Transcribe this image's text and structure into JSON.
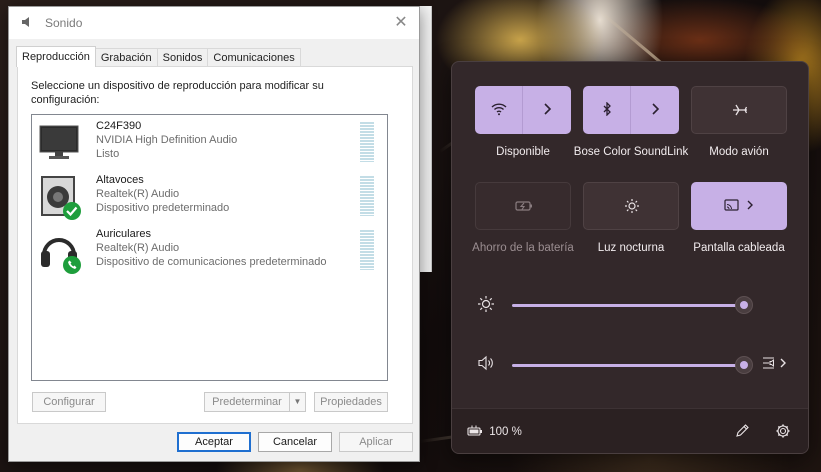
{
  "dialog": {
    "title": "Sonido",
    "close_glyph": "✕",
    "tabs": [
      "Reproducción",
      "Grabación",
      "Sonidos",
      "Comunicaciones"
    ],
    "instruction": "Seleccione un dispositivo de reproducción para modificar su configuración:",
    "devices": [
      {
        "name": "C24F390",
        "line1": "NVIDIA High Definition Audio",
        "line2": "Listo",
        "icon": "monitor-icon"
      },
      {
        "name": "Altavoces",
        "line1": "Realtek(R) Audio",
        "line2": "Dispositivo predeterminado",
        "icon": "speaker-default-icon"
      },
      {
        "name": "Auriculares",
        "line1": "Realtek(R) Audio",
        "line2": "Dispositivo de comunicaciones predeterminado",
        "icon": "headphones-comm-icon"
      }
    ],
    "buttons": {
      "configure": "Configurar",
      "set_default": "Predeterminar",
      "properties": "Propiedades",
      "ok": "Aceptar",
      "cancel": "Cancelar",
      "apply": "Aplicar"
    }
  },
  "quick_settings": {
    "accent": "#c7b0e6",
    "tiles": [
      {
        "label": "Disponible",
        "icon": "wifi-icon",
        "state": "on"
      },
      {
        "label": "Bose Color SoundLink",
        "icon": "bluetooth-icon",
        "state": "on"
      },
      {
        "label": "Modo avión",
        "icon": "airplane-icon",
        "state": "off"
      },
      {
        "label": "Ahorro de la batería",
        "icon": "battery-saver-icon",
        "state": "disabled"
      },
      {
        "label": "Luz nocturna",
        "icon": "night-light-icon",
        "state": "off"
      },
      {
        "label": "Pantalla cableada",
        "icon": "cast-icon",
        "state": "on"
      }
    ],
    "brightness": {
      "icon": "brightness-icon",
      "level": 1.0
    },
    "volume": {
      "icon": "volume-icon",
      "level": 1.0
    },
    "battery_text": "100 %"
  }
}
